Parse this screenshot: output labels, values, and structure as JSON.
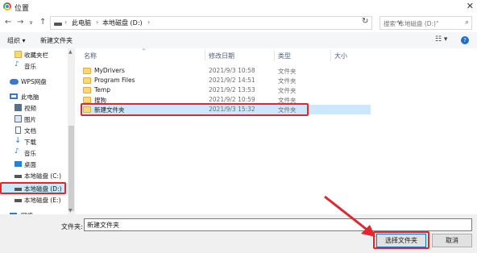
{
  "window": {
    "title": "位置",
    "close": "✕"
  },
  "address": {
    "back": "←",
    "forward": "→",
    "history": "∨",
    "up": "↑",
    "crumbs": [
      "此电脑",
      "本地磁盘 (D:)"
    ],
    "separator": "›",
    "dropdown": "∨",
    "refresh": "↻",
    "search_placeholder": "搜索\"本地磁盘 (D:)\"",
    "search_icon": "🔍"
  },
  "toolbar": {
    "organize": "组织 ▾",
    "new_folder": "新建文件夹",
    "view": "☷ ▾",
    "help": "?"
  },
  "sidebar": {
    "items": [
      {
        "label": "收藏夹栏",
        "icon": "folder-icon",
        "color": "#f8d775"
      },
      {
        "label": "音乐",
        "icon": "music-icon",
        "color": "#3b79c6"
      },
      {
        "label": "WPS网盘",
        "icon": "cloud-icon",
        "color": "#3b79c6"
      },
      {
        "label": "此电脑",
        "icon": "computer-icon",
        "color": "#3b79c6"
      },
      {
        "label": "视频",
        "icon": "video-icon",
        "color": "#5a6f8a"
      },
      {
        "label": "图片",
        "icon": "picture-icon",
        "color": "#5a6f8a"
      },
      {
        "label": "文档",
        "icon": "document-icon",
        "color": "#5a6f8a"
      },
      {
        "label": "下载",
        "icon": "download-icon",
        "color": "#2f7fd0"
      },
      {
        "label": "音乐",
        "icon": "music-icon",
        "color": "#2f7fd0"
      },
      {
        "label": "桌面",
        "icon": "desktop-icon",
        "color": "#2f7fd0"
      },
      {
        "label": "本地磁盘 (C:)",
        "icon": "drive-icon",
        "color": "#555555"
      },
      {
        "label": "本地磁盘 (D:)",
        "icon": "drive-icon",
        "color": "#555555"
      },
      {
        "label": "本地磁盘 (E:)",
        "icon": "drive-icon",
        "color": "#555555"
      },
      {
        "label": "网络",
        "icon": "network-icon",
        "color": "#3b79c6"
      }
    ],
    "selected_index": 11
  },
  "columns": {
    "name": "名称",
    "modified": "修改日期",
    "type": "类型",
    "size": "大小"
  },
  "files": [
    {
      "name": "MyDrivers",
      "modified": "2021/9/3 10:58",
      "type": "文件夹"
    },
    {
      "name": "Program Files",
      "modified": "2021/9/2 14:51",
      "type": "文件夹"
    },
    {
      "name": "Temp",
      "modified": "2021/9/2 13:53",
      "type": "文件夹"
    },
    {
      "name": "搜狗",
      "modified": "2021/9/2 10:59",
      "type": "文件夹"
    },
    {
      "name": "新建文件夹",
      "modified": "2021/9/3 15:32",
      "type": "文件夹"
    }
  ],
  "bottom": {
    "filename_label": "文件夹:",
    "filename_value": "新建文件夹",
    "select_button": "选择文件夹",
    "cancel_button": "取消"
  },
  "colors": {
    "highlight": "#e0262e",
    "selection": "#cce8ff",
    "folder": "#f8d775"
  }
}
